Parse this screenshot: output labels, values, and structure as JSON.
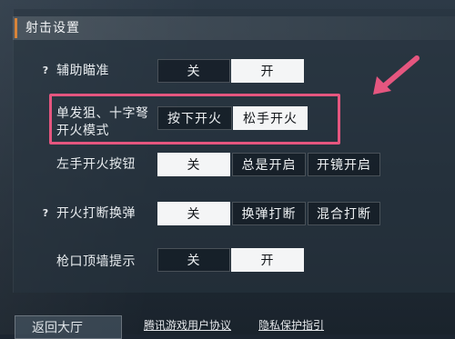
{
  "section": {
    "title": "射击设置"
  },
  "settings": [
    {
      "label": "辅助瞄准",
      "help": "?",
      "options": [
        "关",
        "开"
      ],
      "selected": "开"
    },
    {
      "label_line1": "单发狙、十字弩",
      "label_line2": "开火模式",
      "options": [
        "按下开火",
        "松手开火"
      ],
      "selected": "松手开火"
    },
    {
      "label": "左手开火按钮",
      "options": [
        "关",
        "总是开启",
        "开镜开启"
      ],
      "selected": "关"
    },
    {
      "label": "开火打断换弹",
      "help": "?",
      "options": [
        "关",
        "换弹打断",
        "混合打断"
      ],
      "selected": "关"
    },
    {
      "label": "枪口顶墙提示",
      "options": [
        "关",
        "开"
      ],
      "selected": "开"
    }
  ],
  "footer": {
    "back_button": "返回大厅",
    "links": [
      "腾讯游戏用户协议",
      "隐私保护指引"
    ]
  },
  "colors": {
    "accent": "#d8843a",
    "highlight": "#e5567f",
    "selected_bg": "#f4f5f6"
  }
}
